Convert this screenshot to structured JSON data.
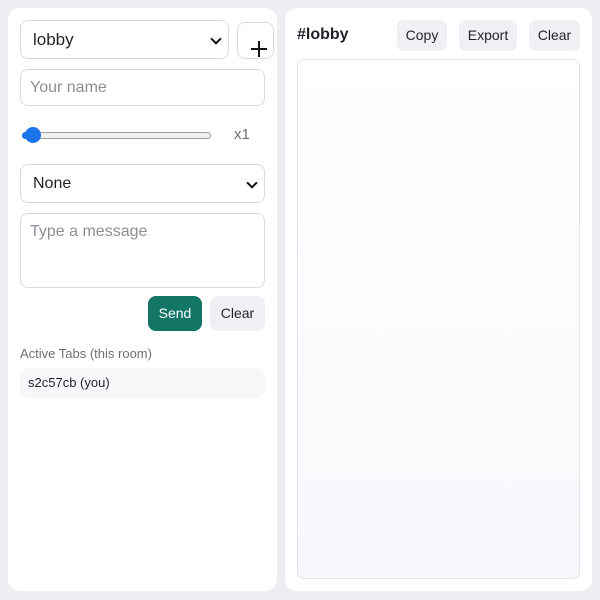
{
  "sidebar": {
    "room_select": {
      "selected": "lobby"
    },
    "add_room_symbol": "+",
    "name_input": {
      "value": "",
      "placeholder": "Your name"
    },
    "speed_slider": {
      "value": 1,
      "min": 1,
      "max": 10,
      "label": "x1"
    },
    "effect_select": {
      "selected": "None"
    },
    "message_input": {
      "value": "",
      "placeholder": "Type a message"
    },
    "send_label": "Send",
    "clear_label": "Clear",
    "active_tabs": {
      "title": "Active Tabs (this room)",
      "items": [
        {
          "label": "s2c57cb (you)"
        }
      ]
    }
  },
  "log_panel": {
    "title": "#lobby",
    "copy_label": "Copy",
    "export_label": "Export",
    "clear_label": "Clear"
  },
  "colors": {
    "accent": "#127566",
    "slider": "#1a73e8",
    "background": "#eceef1"
  }
}
